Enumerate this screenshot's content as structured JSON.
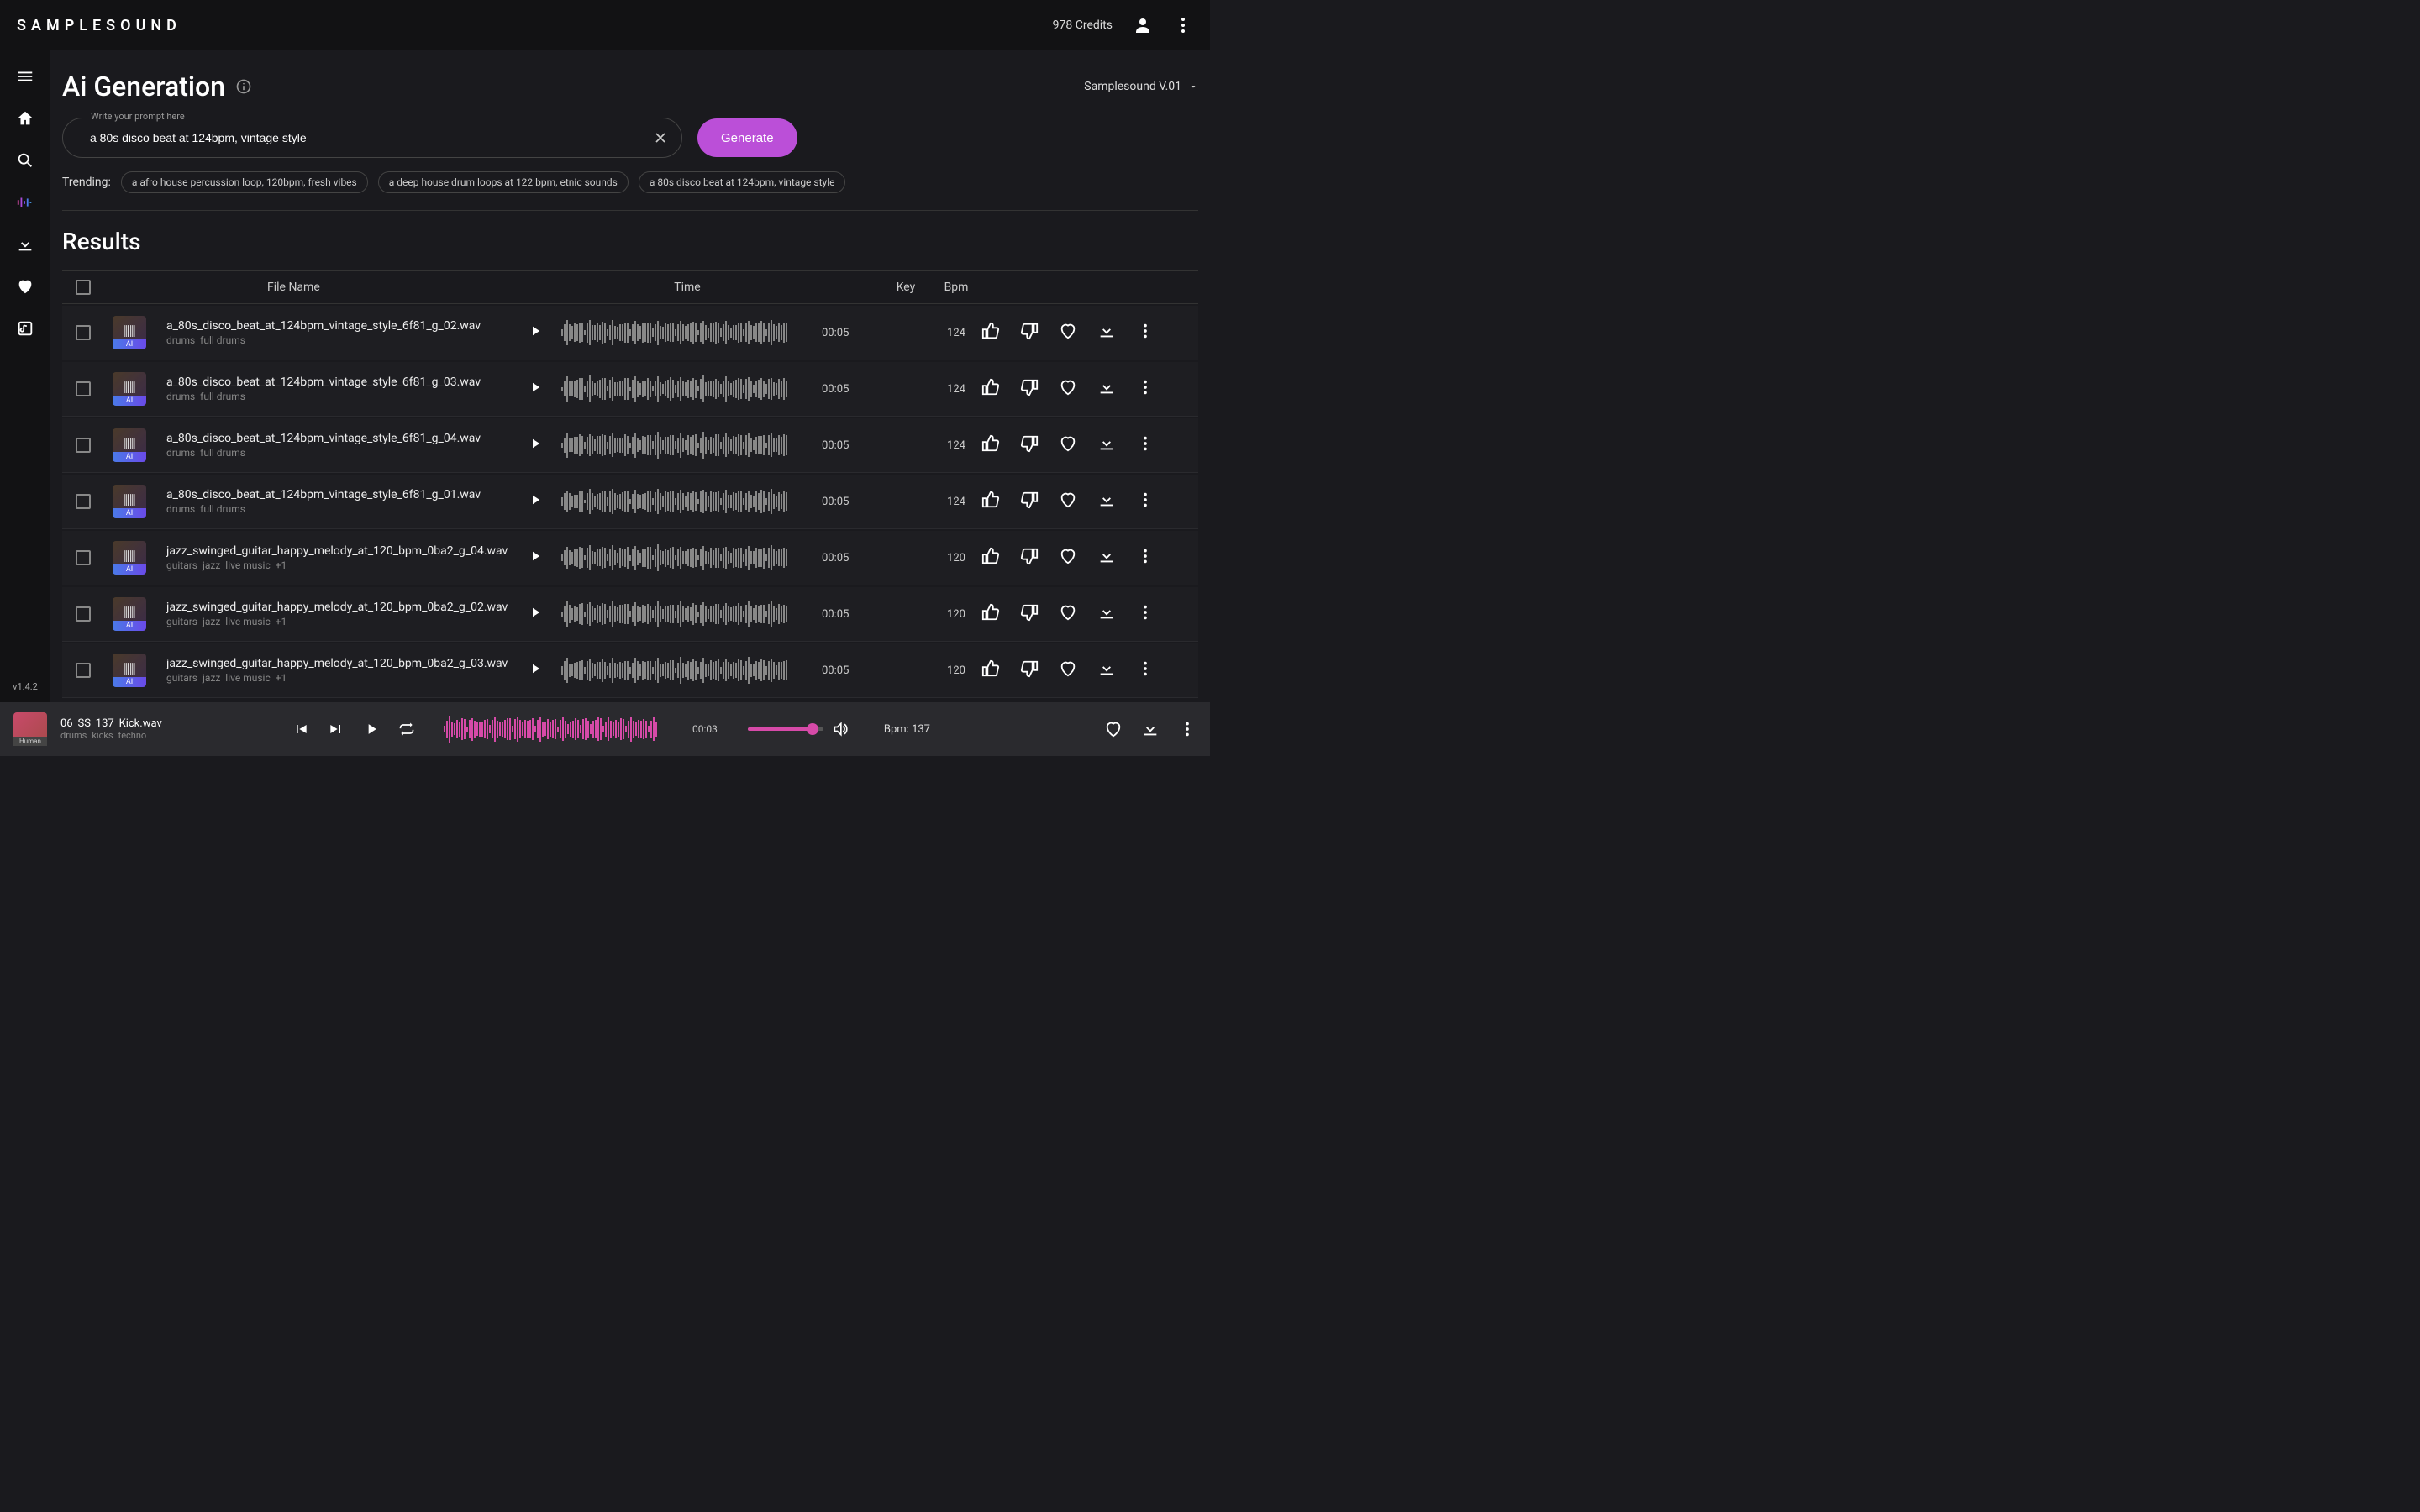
{
  "header": {
    "logo": "SAMPLESOUND",
    "credits": "978 Credits"
  },
  "sidebar": {
    "version": "v1.4.2"
  },
  "page": {
    "title": "Ai Generation",
    "model": "Samplesound V.01",
    "prompt_label": "Write your prompt here",
    "prompt_value": "a 80s disco beat at 124bpm, vintage style",
    "generate": "Generate",
    "trending_label": "Trending:",
    "trending_chips": [
      "a afro house percussion loop, 120bpm, fresh vibes",
      "a deep house drum loops at 122 bpm, etnic sounds",
      "a 80s disco beat at 124bpm, vintage style"
    ],
    "results_title": "Results"
  },
  "table": {
    "headers": {
      "file": "File Name",
      "time": "Time",
      "key": "Key",
      "bpm": "Bpm"
    },
    "rows": [
      {
        "name": "a_80s_disco_beat_at_124bpm_vintage_style_6f81_g_02.wav",
        "tags": [
          "drums",
          "full drums"
        ],
        "time": "00:05",
        "key": "",
        "bpm": "124",
        "ai": "AI"
      },
      {
        "name": "a_80s_disco_beat_at_124bpm_vintage_style_6f81_g_03.wav",
        "tags": [
          "drums",
          "full drums"
        ],
        "time": "00:05",
        "key": "",
        "bpm": "124",
        "ai": "AI"
      },
      {
        "name": "a_80s_disco_beat_at_124bpm_vintage_style_6f81_g_04.wav",
        "tags": [
          "drums",
          "full drums"
        ],
        "time": "00:05",
        "key": "",
        "bpm": "124",
        "ai": "AI"
      },
      {
        "name": "a_80s_disco_beat_at_124bpm_vintage_style_6f81_g_01.wav",
        "tags": [
          "drums",
          "full drums"
        ],
        "time": "00:05",
        "key": "",
        "bpm": "124",
        "ai": "AI"
      },
      {
        "name": "jazz_swinged_guitar_happy_melody_at_120_bpm_0ba2_g_04.wav",
        "tags": [
          "guitars",
          "jazz",
          "live music",
          "+1"
        ],
        "time": "00:05",
        "key": "",
        "bpm": "120",
        "ai": "AI"
      },
      {
        "name": "jazz_swinged_guitar_happy_melody_at_120_bpm_0ba2_g_02.wav",
        "tags": [
          "guitars",
          "jazz",
          "live music",
          "+1"
        ],
        "time": "00:05",
        "key": "",
        "bpm": "120",
        "ai": "AI"
      },
      {
        "name": "jazz_swinged_guitar_happy_melody_at_120_bpm_0ba2_g_03.wav",
        "tags": [
          "guitars",
          "jazz",
          "live music",
          "+1"
        ],
        "time": "00:05",
        "key": "",
        "bpm": "120",
        "ai": "AI"
      }
    ]
  },
  "player": {
    "thumb_label": "Human",
    "name": "06_SS_137_Kick.wav",
    "tags": [
      "drums",
      "kicks",
      "techno"
    ],
    "time": "00:03",
    "bpm_label": "Bpm: 137"
  }
}
